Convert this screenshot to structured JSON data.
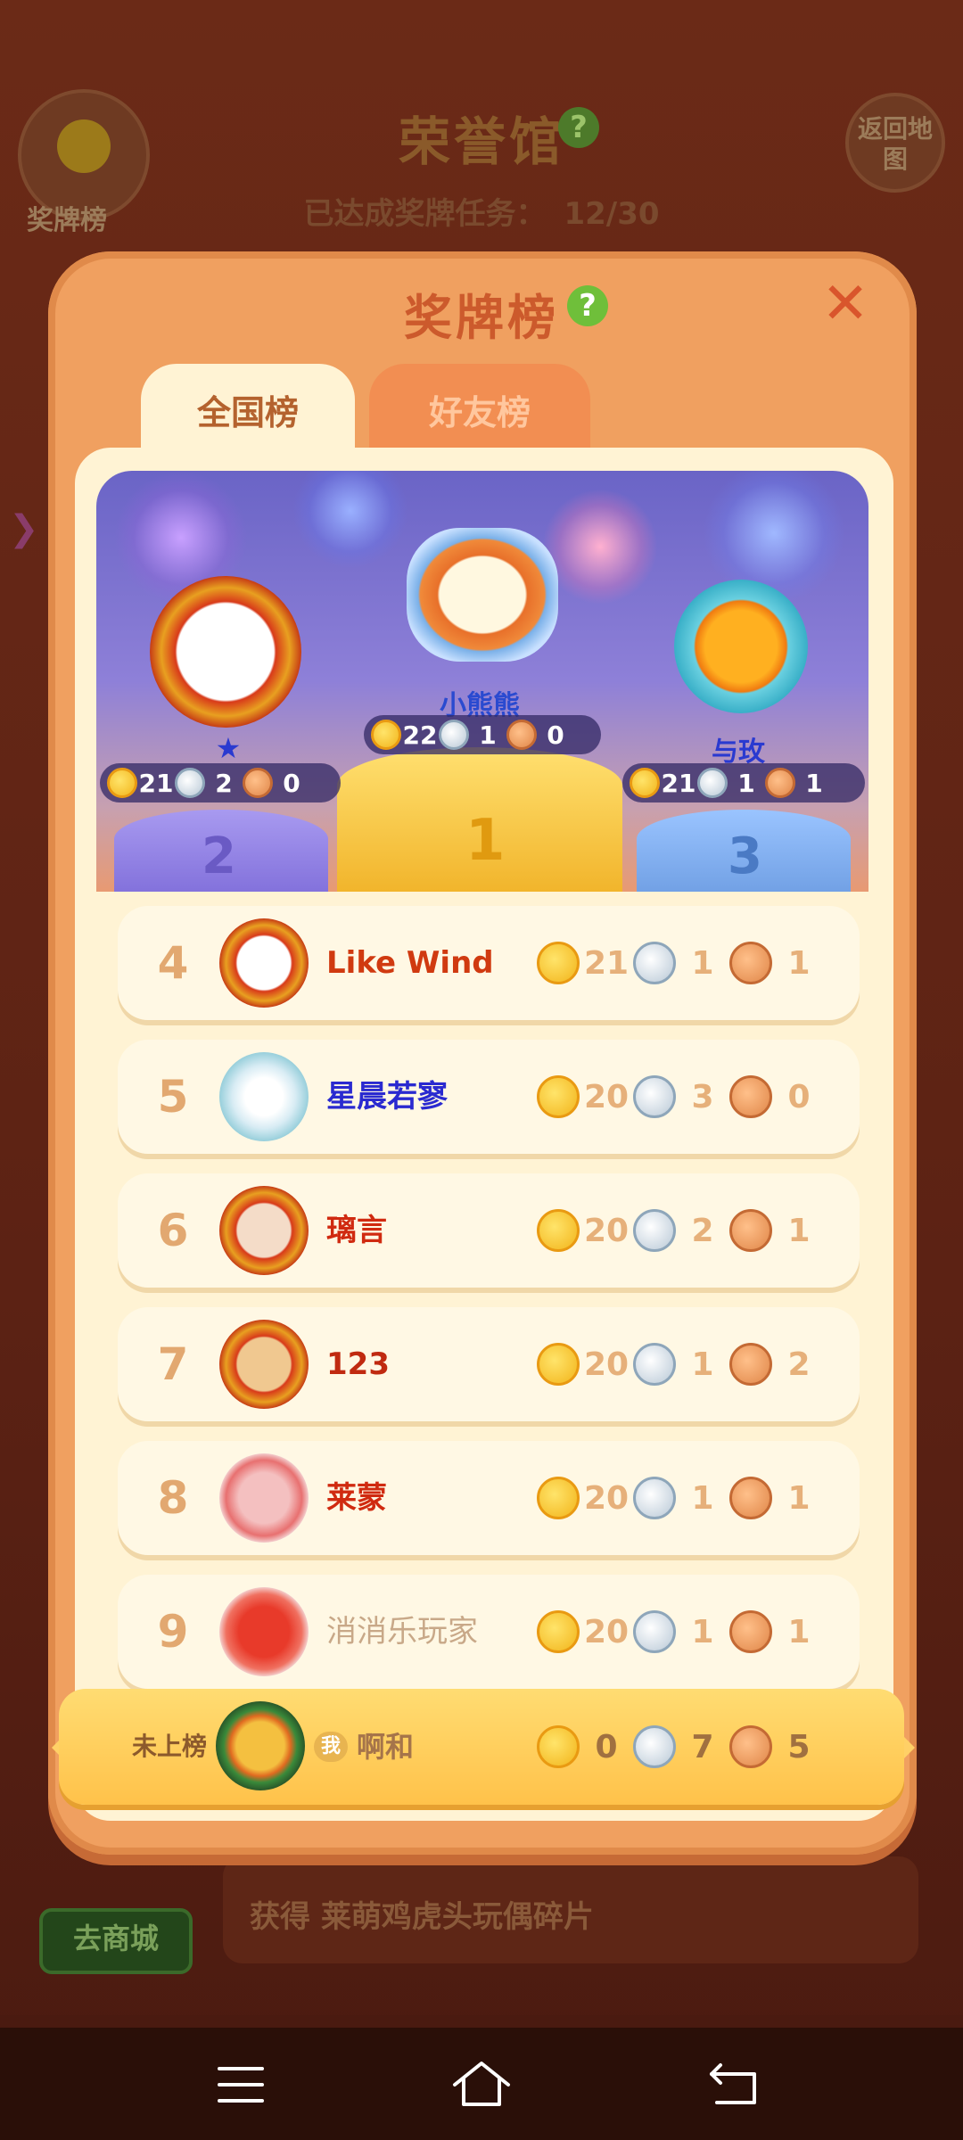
{
  "background": {
    "title": "荣誉馆",
    "progress_label": "已达成奖牌任务：",
    "progress_value": "12/30",
    "badge_label": "奖牌榜",
    "return_button": "返回地图",
    "shop_button": "去商城",
    "reward_text": "获得 莱萌鸡虎头玩偶碎片"
  },
  "modal": {
    "title": "奖牌榜",
    "tabs": [
      {
        "label": "全国榜",
        "active": true
      },
      {
        "label": "好友榜",
        "active": false
      }
    ]
  },
  "podium": [
    {
      "rank": "1",
      "name": "小熊熊",
      "gold": "22",
      "silver": "1",
      "bronze": "0"
    },
    {
      "rank": "2",
      "name": "★",
      "gold": "21",
      "silver": "2",
      "bronze": "0"
    },
    {
      "rank": "3",
      "name": "与玫",
      "gold": "21",
      "silver": "1",
      "bronze": "1"
    }
  ],
  "leaderboard": [
    {
      "rank": "4",
      "name": "Like Wind",
      "gold": "21",
      "silver": "1",
      "bronze": "1",
      "name_color": "#d03a10"
    },
    {
      "rank": "5",
      "name": "星晨若寥",
      "gold": "20",
      "silver": "3",
      "bronze": "0",
      "name_color": "#2a2ad0"
    },
    {
      "rank": "6",
      "name": "璃言",
      "gold": "20",
      "silver": "2",
      "bronze": "1",
      "name_color": "#d02a10"
    },
    {
      "rank": "7",
      "name": "123",
      "gold": "20",
      "silver": "1",
      "bronze": "2",
      "name_color": "#c02a10"
    },
    {
      "rank": "8",
      "name": "莱蒙",
      "gold": "20",
      "silver": "1",
      "bronze": "1",
      "name_color": "#d02a10"
    },
    {
      "rank": "9",
      "name": "消消乐玩家",
      "gold": "20",
      "silver": "1",
      "bronze": "1",
      "name_color": "#c8a888"
    }
  ],
  "self": {
    "status": "未上榜",
    "me_tag": "我",
    "name": "啊和",
    "gold": "0",
    "silver": "7",
    "bronze": "5"
  },
  "navbar": {
    "icons": [
      "menu-icon",
      "home-icon",
      "back-icon"
    ]
  }
}
